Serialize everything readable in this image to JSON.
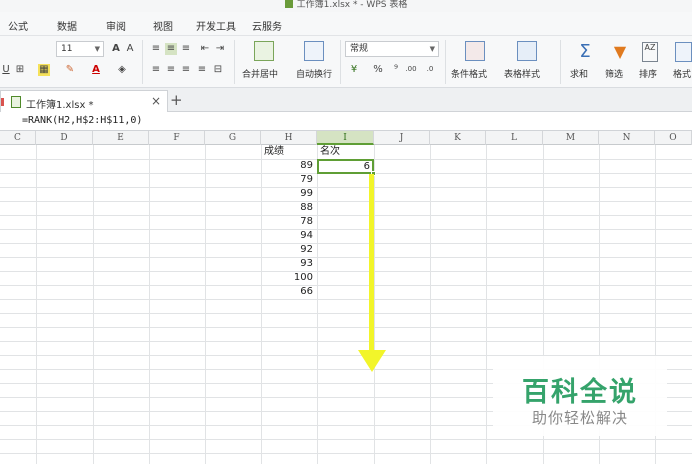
{
  "window": {
    "title": "工作簿1.xlsx * - WPS 表格"
  },
  "menu": {
    "formula": "公式",
    "data": "数据",
    "review": "审阅",
    "view": "视图",
    "developer": "开发工具",
    "cloud": "云服务"
  },
  "ribbon": {
    "font_size": "11",
    "number_format": "常规",
    "merge_center": "合并居中",
    "wrap_text": "自动换行",
    "conditional_format": "条件格式",
    "table_style": "表格样式",
    "sum": "求和",
    "filter": "筛选",
    "sort": "排序",
    "format": "格式",
    "percent": "%",
    "comma": "⁹",
    "inc_decimal": ".00",
    "dec_decimal": ".0"
  },
  "tabs": {
    "document": "工作簿1.xlsx *",
    "close": "×",
    "new": "+"
  },
  "formula_bar": {
    "formula": "=RANK(H2,H$2:H$11,0)"
  },
  "columns": [
    "C",
    "D",
    "E",
    "F",
    "G",
    "H",
    "I",
    "J",
    "K",
    "L",
    "M",
    "N",
    "O"
  ],
  "sheet": {
    "header_score": "成绩",
    "header_rank": "名次",
    "scores": [
      "89",
      "79",
      "99",
      "88",
      "78",
      "94",
      "92",
      "93",
      "100",
      "66"
    ],
    "rank_values": [
      "6"
    ]
  },
  "watermark": {
    "title": "百科全说",
    "subtitle": "助你轻松解决"
  },
  "colors": {
    "accent_green": "#5f9e35",
    "arrow_yellow": "#f2f52a",
    "watermark_green": "#35a36b"
  }
}
